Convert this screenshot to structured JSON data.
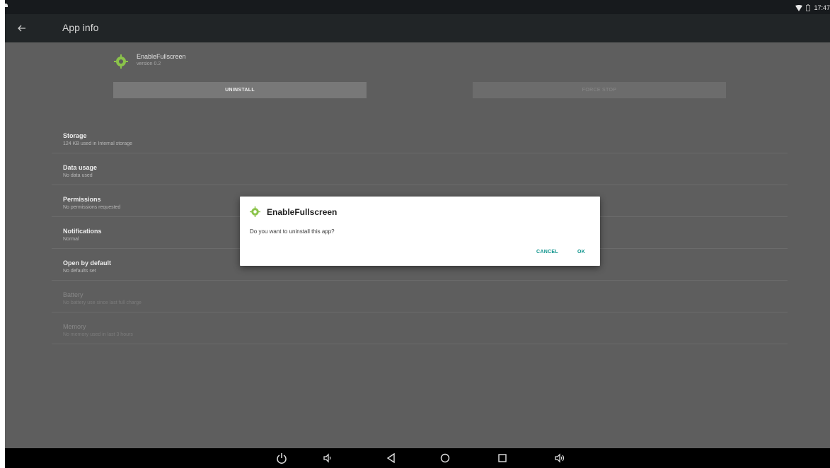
{
  "status_bar": {
    "time": "17:47"
  },
  "action_bar": {
    "title": "App info"
  },
  "app": {
    "name": "EnableFullscreen",
    "version": "version 0.2"
  },
  "buttons": {
    "uninstall": "UNINSTALL",
    "force_stop": "FORCE STOP"
  },
  "settings": [
    {
      "title": "Storage",
      "subtitle": "124 KB used in Internal storage",
      "enabled": true
    },
    {
      "title": "Data usage",
      "subtitle": "No data used",
      "enabled": true
    },
    {
      "title": "Permissions",
      "subtitle": "No permissions requested",
      "enabled": true
    },
    {
      "title": "Notifications",
      "subtitle": "Normal",
      "enabled": true
    },
    {
      "title": "Open by default",
      "subtitle": "No defaults set",
      "enabled": true
    },
    {
      "title": "Battery",
      "subtitle": "No battery use since last full charge",
      "enabled": false
    },
    {
      "title": "Memory",
      "subtitle": "No memory used in last 3 hours",
      "enabled": false
    }
  ],
  "dialog": {
    "title": "EnableFullscreen",
    "message": "Do you want to uninstall this app?",
    "cancel_label": "CANCEL",
    "ok_label": "OK"
  },
  "nav_bar": {
    "icons": [
      "power-icon",
      "volume-down-icon",
      "back-triangle-icon",
      "home-circle-icon",
      "recents-square-icon",
      "volume-up-icon"
    ]
  },
  "colors": {
    "dialog_accent": "#0e938c",
    "android_green": "#8bc34a",
    "dim_background": "#5e5e5e"
  }
}
